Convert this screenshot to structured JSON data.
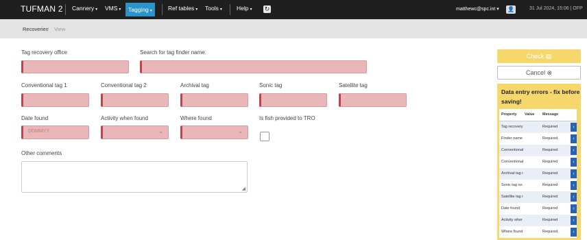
{
  "app": {
    "title": "TUFMAN 2"
  },
  "nav": {
    "items": [
      {
        "label": "Cannery",
        "caret": "▾"
      },
      {
        "label": "VMS",
        "caret": "▾"
      },
      {
        "label": "Tagging",
        "caret": "▾"
      },
      {
        "label": "Ref tables",
        "caret": "▾"
      },
      {
        "label": "Tools",
        "caret": "▾"
      },
      {
        "label": "Help",
        "caret": "▾"
      }
    ],
    "active": "Tagging"
  },
  "header": {
    "user": "matthewc@spc.int ▾",
    "datetime": "31 Jul 2024, 15:06 | OFP"
  },
  "breadcrumb": {
    "parent": "Recoveries",
    "separator": "/",
    "current": "View"
  },
  "form": {
    "tag_recovery_office": "Tag recovery office",
    "tag_finder_search": "Search for tag finder name:",
    "conventional_tag_1": "Conventional tag 1",
    "conventional_tag_2": "Conventional tag 2",
    "archival_tag": "Archival tag",
    "sonic_tag": "Sonic tag",
    "satellite_tag": "Satellite tag",
    "date_found": "Date found",
    "date_placeholder": "DDMMYY",
    "activity_when_found": "Activity when found",
    "where_found": "Where found",
    "fish_provided": "Is fish provided to TRO",
    "other_comments": "Other comments"
  },
  "actions": {
    "check_label": "Check",
    "cancel_label": "Cancel"
  },
  "errors": {
    "title": "Data entry errors - fix before saving!",
    "headers": [
      "Property",
      "Value",
      "Message"
    ],
    "rows": [
      {
        "property": "Tag recovery",
        "value": "",
        "message": "Required"
      },
      {
        "property": "Finder name",
        "value": "",
        "message": "Required"
      },
      {
        "property": "Conventional",
        "value": "",
        "message": "Required"
      },
      {
        "property": "Conventional",
        "value": "",
        "message": "Required"
      },
      {
        "property": "Archival tag r",
        "value": "",
        "message": "Required"
      },
      {
        "property": "Sonic tag no.",
        "value": "",
        "message": "Required"
      },
      {
        "property": "Satellite tag r",
        "value": "",
        "message": "Required"
      },
      {
        "property": "Date found",
        "value": "",
        "message": "Required"
      },
      {
        "property": "Activity wher",
        "value": "",
        "message": "Required"
      },
      {
        "property": "Where found",
        "value": "",
        "message": "Required"
      }
    ]
  },
  "colors": {
    "nav_active": "#2a93c9",
    "invalid_field": "#e9b7b9",
    "invalid_border": "#c0424a",
    "check": "#f5d76b",
    "row_action": "#2763b0"
  }
}
